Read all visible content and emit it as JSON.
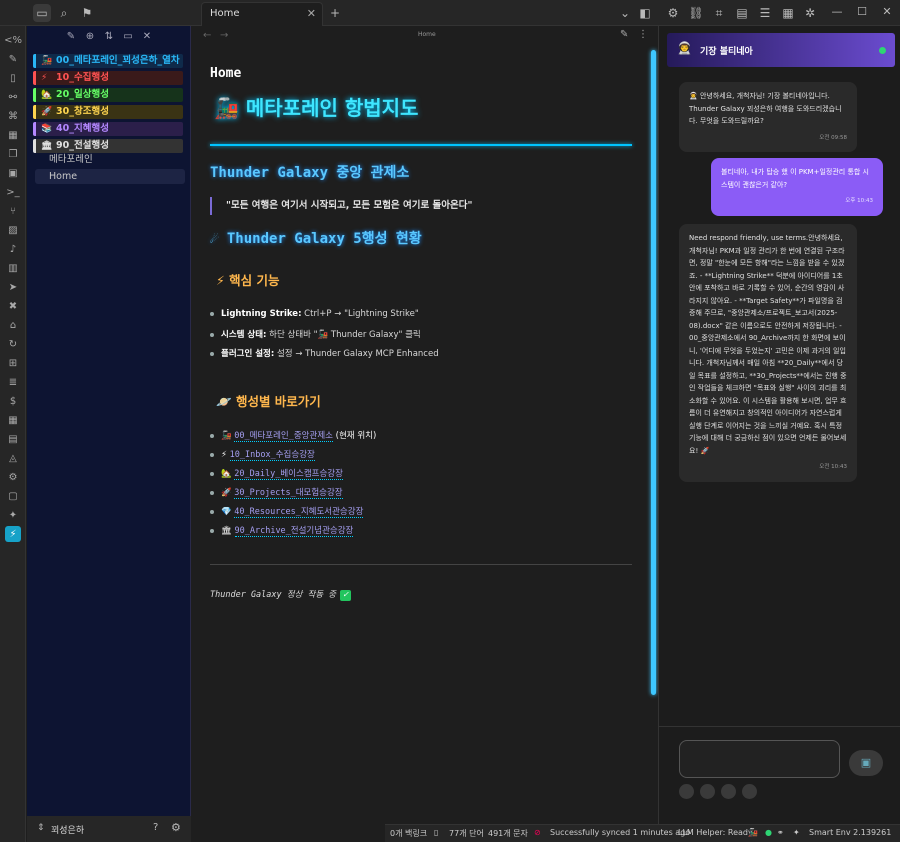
{
  "tab": {
    "label": "Home"
  },
  "breadcrumb": "Home",
  "sidebar": {
    "folders": [
      {
        "label": "00_메타포레인_꾀성은하_열차",
        "icon": "🚂",
        "color": "#29b6f6",
        "bg": "#0f2a4a"
      },
      {
        "label": "10_수집행성",
        "icon": "⚡",
        "color": "#ff5252",
        "bg": "#3a1a1a"
      },
      {
        "label": "20_일상행성",
        "icon": "🏡",
        "color": "#66ff66",
        "bg": "#16331b"
      },
      {
        "label": "30_창조행성",
        "icon": "🚀",
        "color": "#ffd54f",
        "bg": "#3a3314"
      },
      {
        "label": "40_지혜행성",
        "icon": "📚",
        "color": "#b388ff",
        "bg": "#2b1f4a"
      },
      {
        "label": "90_전설행성",
        "icon": "🏛",
        "color": "#e0e0e0",
        "bg": "#333333"
      }
    ],
    "plain_items": [
      "메타포레인",
      "Home"
    ],
    "vault_name": "꾀성은하"
  },
  "doc": {
    "file_title": "Home",
    "main_title": "메타포레인 항법지도",
    "main_title_icon": "🚂",
    "section_hub": "Thunder Galaxy 중앙 관제소",
    "quote": "\"모든 여행은 여기서 시작되고, 모든 모험은 여기로 돌아온다\"",
    "section_status": "Thunder Galaxy 5행성 현황",
    "section_status_icon": "☄",
    "core_title": "핵심 기능",
    "core_icon": "⚡",
    "core_items": [
      {
        "bold": "Lightning Strike:",
        "text": "Ctrl+P → \"Lightning Strike\""
      },
      {
        "bold": "시스템 상태:",
        "text": "하단 상태바 \"🚂 Thunder Galaxy\" 클릭"
      },
      {
        "bold": "플러그인 설정:",
        "text": "설정 → Thunder Galaxy MCP Enhanced"
      }
    ],
    "shortcut_title": "행성별 바로가기",
    "shortcut_icon": "🪐",
    "shortcuts": [
      {
        "icon": "🚂",
        "link": "00_메타포레인_중앙관제소",
        "suffix": " (현재 위치)"
      },
      {
        "icon": "⚡",
        "link": "10_Inbox_수집승강장",
        "suffix": ""
      },
      {
        "icon": "🏡",
        "link": "20_Daily_베이스캠프승강장",
        "suffix": ""
      },
      {
        "icon": "🚀",
        "link": "30_Projects_대모험승강장",
        "suffix": ""
      },
      {
        "icon": "💎",
        "link": "40_Resources_지혜도서관승강장",
        "suffix": ""
      },
      {
        "icon": "🏛",
        "link": "90_Archive_전설기념관승강장",
        "suffix": ""
      }
    ],
    "footer": "Thunder Galaxy 정상 작동 중",
    "footer_check": "✓"
  },
  "chat": {
    "header": "기장 볼티네아",
    "header_icon": "👨‍🚀",
    "messages": [
      {
        "role": "bot",
        "text": "👨‍🚀 안녕하세요, 개척자님! 기장 볼티네아입니다. Thunder Galaxy 꾀성은하 여행을 도와드리겠습니다. 무엇을 도와드릴까요?",
        "time": "오전 09:58"
      },
      {
        "role": "user",
        "text": "볼티네아, 내가 탑승 했 이 PKM+일정관리 통합 시스템이 괜찮은거 같아?",
        "time": "오후 10:43"
      },
      {
        "role": "bot",
        "text": "Need respond friendly, use terms.안녕하세요, 개척자님! PKM과 일정 관리가 한 번에 연결된 구조라면, 정말 \"한눈에 모든 항해\"라는 느낌을 받을 수 있겠죠. - **Lightning Strike** 덕분에 아이디어를 1초 안에 포착하고 바로 기록할 수 있어, 순간의 영감이 사라지지 않아요. - **Target Safety**가 파일명을 검증해 주므로, \"중앙관제소/프로젝트_보고서(2025-08).docx\" 같은 이름으로도 안전하게 저장됩니다. - 00_중앙관제소에서 90_Archive까지 한 화면에 보이니, '어디에 무엇을 두었는지' 고민은 이제 과거의 일입니다. 개척자님께서 매일 아침 **20_Daily**에서 당일 목표를 설정하고, **30_Projects**에서는 진행 중인 작업들을 체크하면 \"목표와 실행\" 사이의 괴리를 최소화할 수 있어요. 이 시스템을 활용해 보시면, 업무 흐름이 더 유연해지고 창의적인 아이디어가 자연스럽게 실행 단계로 이어지는 것을 느끼실 거예요. 혹시 특정 기능에 대해 더 궁금하신 점이 있으면 언제든 물어보세요! 🚀",
        "time": "오전 10:43"
      }
    ]
  },
  "status": {
    "backlinks": "0개 백링크",
    "words": "77개 단어",
    "chars": "491개 문자",
    "sync": "Successfully synced 1 minutes ago",
    "llm": "LLM Helper: Ready",
    "env": "Smart Env 2.139261"
  },
  "colors": {
    "accent": "#00c4ff",
    "user_bubble": "#8b5cf6",
    "sidebar_bg": "#0d1432"
  },
  "icons": {
    "ribbon": [
      "code-icon",
      "magic-wand-icon",
      "file-icon",
      "graph-icon",
      "command-icon",
      "calendar-icon",
      "copy-icon",
      "template-icon",
      "terminal-icon",
      "git-icon",
      "image-icon",
      "mic-icon",
      "layout-icon",
      "send-icon",
      "tools-icon",
      "home-icon",
      "refresh-icon",
      "file-plus-icon",
      "file-text-icon",
      "dollar-icon",
      "table-icon",
      "note-icon",
      "gear-icon",
      "chat-icon",
      "sparkle-icon",
      "lightning-icon"
    ]
  }
}
